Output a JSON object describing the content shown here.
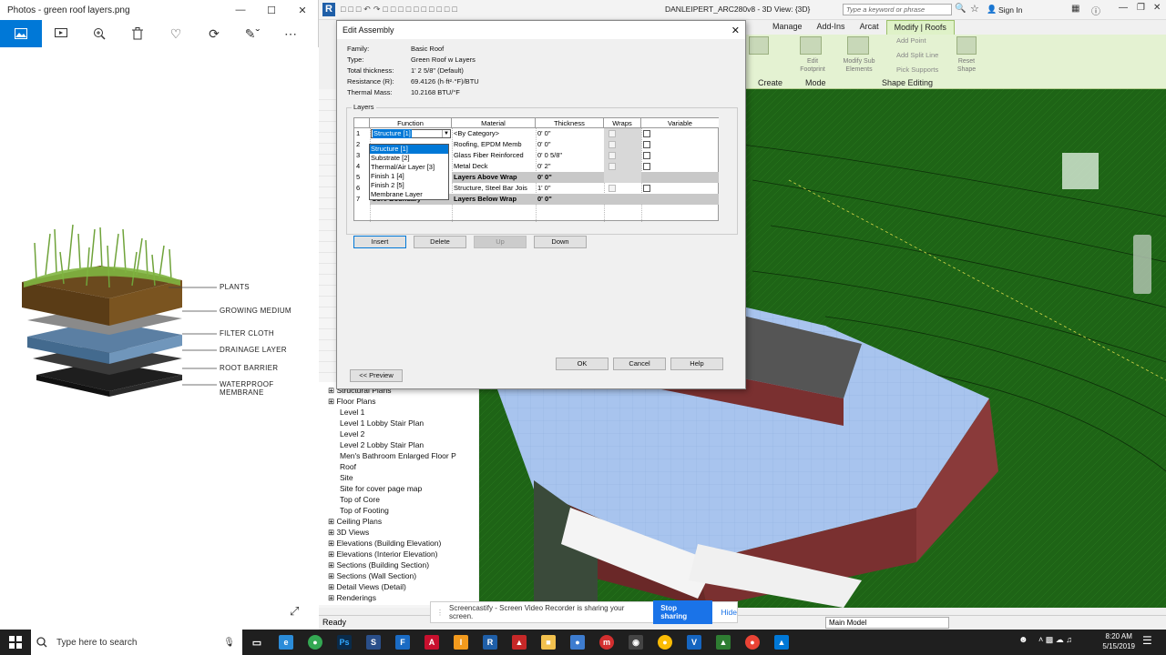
{
  "photos": {
    "title": "Photos - green roof layers.png",
    "tools": [
      "image-icon",
      "slideshow-icon",
      "zoom-icon",
      "delete-icon",
      "heart-icon",
      "rotate-icon",
      "edit-icon",
      "more-icon"
    ],
    "layer_labels": [
      "PLANTS",
      "GROWING MEDIUM",
      "FILTER CLOTH",
      "DRAINAGE LAYER",
      "ROOT BARRIER",
      "WATERPROOF MEMBRANE"
    ]
  },
  "revit": {
    "title": "DANLEIPERT_ARC280v8 - 3D View: {3D}",
    "search_placeholder": "Type a keyword or phrase",
    "sign_in": "Sign In",
    "tabs": [
      "Manage",
      "Add-Ins",
      "Arcat",
      "Modify | Roofs"
    ],
    "ribbon": {
      "edit_footprint": "Edit Footprint",
      "modify_sub": "Modify Sub Elements",
      "add_point": "Add Point",
      "add_split": "Add Split Line",
      "pick_supports": "Pick Supports",
      "reset_shape": "Reset Shape",
      "groups": [
        "Create",
        "Mode",
        "Shape Editing"
      ]
    },
    "status": "Ready",
    "main_model": "Main Model",
    "browser_items": [
      {
        "label": "Structural Plans",
        "level": 1
      },
      {
        "label": "Floor Plans",
        "level": 1
      },
      {
        "label": "Level 1",
        "level": 2
      },
      {
        "label": "Level 1 Lobby Stair Plan",
        "level": 2
      },
      {
        "label": "Level 2",
        "level": 2
      },
      {
        "label": "Level 2 Lobby Stair Plan",
        "level": 2
      },
      {
        "label": "Men's Bathroom Enlarged Floor P",
        "level": 2
      },
      {
        "label": "Roof",
        "level": 2
      },
      {
        "label": "Site",
        "level": 2
      },
      {
        "label": "Site for cover page map",
        "level": 2
      },
      {
        "label": "Top of Core",
        "level": 2
      },
      {
        "label": "Top of Footing",
        "level": 2
      },
      {
        "label": "Ceiling Plans",
        "level": 1
      },
      {
        "label": "3D Views",
        "level": 1
      },
      {
        "label": "Elevations (Building Elevation)",
        "level": 1
      },
      {
        "label": "Elevations (Interior Elevation)",
        "level": 1
      },
      {
        "label": "Sections (Building Section)",
        "level": 1
      },
      {
        "label": "Sections (Wall Section)",
        "level": 1
      },
      {
        "label": "Detail Views (Detail)",
        "level": 1
      },
      {
        "label": "Renderings",
        "level": 1
      }
    ]
  },
  "dialog": {
    "title": "Edit Assembly",
    "family_label": "Family:",
    "family_value": "Basic Roof",
    "type_label": "Type:",
    "type_value": "Green Roof w Layers",
    "thickness_label": "Total thickness:",
    "thickness_value": "1'  2 5/8\" (Default)",
    "resistance_label": "Resistance (R):",
    "resistance_value": "69.4126 (h·ft²·°F)/BTU",
    "mass_label": "Thermal Mass:",
    "mass_value": "10.2168 BTU/°F",
    "layers_label": "Layers",
    "columns": [
      "Function",
      "Material",
      "Thickness",
      "Wraps",
      "Variable"
    ],
    "rows": [
      {
        "n": "1",
        "function": "Structure [1]",
        "material": "<By Category>",
        "thickness": "0'  0\"",
        "bold": false
      },
      {
        "n": "2",
        "function": "",
        "material": "Roofing, EPDM Memb",
        "thickness": "0'  0\"",
        "bold": false
      },
      {
        "n": "3",
        "function": "",
        "material": "Glass Fiber Reinforced",
        "thickness": "0'  0 5/8\"",
        "bold": false
      },
      {
        "n": "4",
        "function": "",
        "material": "Metal Deck",
        "thickness": "0'  2\"",
        "bold": false
      },
      {
        "n": "5",
        "function": "",
        "material": "Layers Above Wrap",
        "thickness": "0'  0\"",
        "bold": true
      },
      {
        "n": "6",
        "function": "",
        "material": "Structure, Steel Bar Jois",
        "thickness": "1'  0\"",
        "bold": false
      },
      {
        "n": "7",
        "function": "Core Boundary",
        "material": "Layers Below Wrap",
        "thickness": "0'  0\"",
        "bold": true
      }
    ],
    "dropdown_options": [
      "Structure [1]",
      "Substrate [2]",
      "Thermal/Air Layer [3]",
      "Finish 1 [4]",
      "Finish 2 [5]",
      "Membrane Layer"
    ],
    "insert": "Insert",
    "delete": "Delete",
    "up": "Up",
    "down": "Down",
    "preview": "<< Preview",
    "ok": "OK",
    "cancel": "Cancel",
    "help": "Help"
  },
  "screencastify": {
    "message": "Screencastify - Screen Video Recorder is sharing your screen.",
    "stop": "Stop sharing",
    "hide": "Hide"
  },
  "taskbar": {
    "search_placeholder": "Type here to search",
    "time": "8:20 AM",
    "date": "5/15/2019"
  }
}
